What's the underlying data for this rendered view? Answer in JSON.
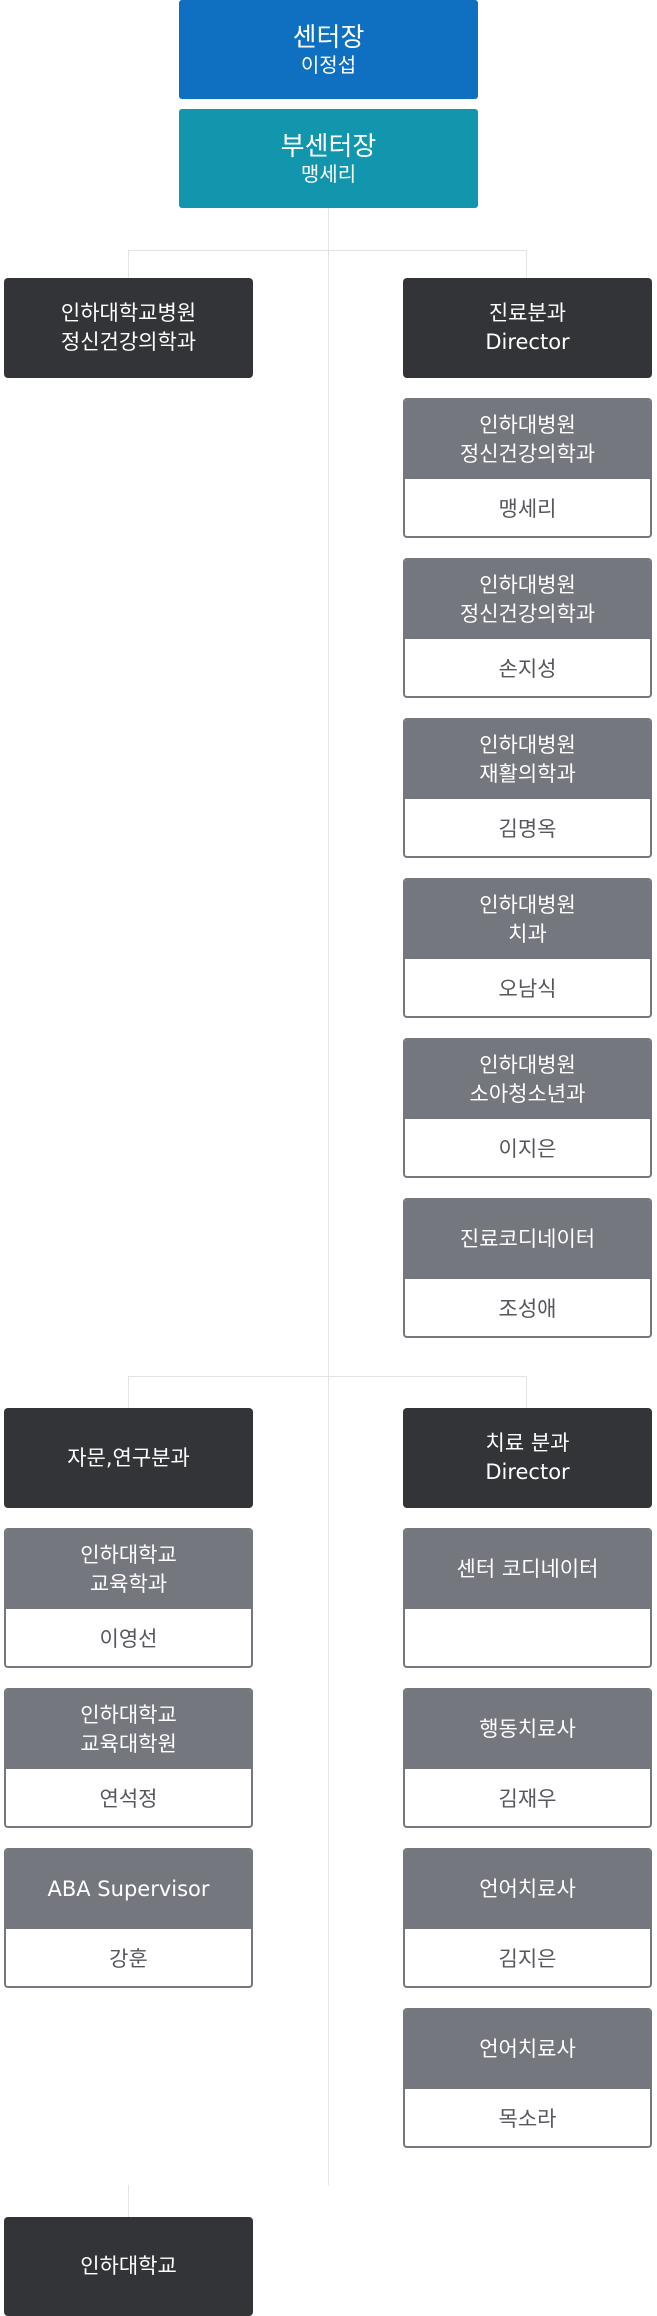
{
  "center_head": {
    "title": "센터장",
    "name": "이정섭"
  },
  "deputy_head": {
    "title": "부센터장",
    "name": "맹세리"
  },
  "left_top": {
    "line1": "인하대학교병원",
    "line2": "정신건강의학과"
  },
  "clinical": {
    "header": {
      "line1": "진료분과",
      "line2": "Director"
    },
    "members": [
      {
        "line1": "인하대병원",
        "line2": "정신건강의학과",
        "name": "맹세리"
      },
      {
        "line1": "인하대병원",
        "line2": "정신건강의학과",
        "name": "손지성"
      },
      {
        "line1": "인하대병원",
        "line2": "재활의학과",
        "name": "김명옥"
      },
      {
        "line1": "인하대병원",
        "line2": "치과",
        "name": "오남식"
      },
      {
        "line1": "인하대병원",
        "line2": "소아청소년과",
        "name": "이지은"
      },
      {
        "line1": "진료코디네이터",
        "line2": "",
        "name": "조성애"
      }
    ]
  },
  "advisory": {
    "header": "자문,연구분과",
    "members": [
      {
        "line1": "인하대학교",
        "line2": "교육학과",
        "name": "이영선"
      },
      {
        "line1": "인하대학교",
        "line2": "교육대학원",
        "name": "연석정"
      },
      {
        "line1": "ABA Supervisor",
        "line2": "",
        "name": "강훈"
      }
    ]
  },
  "treatment": {
    "header": {
      "line1": "치료 분과",
      "line2": "Director"
    },
    "members": [
      {
        "line1": "센터 코디네이터",
        "line2": "",
        "name": ""
      },
      {
        "line1": "행동치료사",
        "line2": "",
        "name": "김재우"
      },
      {
        "line1": "언어치료사",
        "line2": "",
        "name": "김지은"
      },
      {
        "line1": "언어치료사",
        "line2": "",
        "name": "목소라"
      }
    ]
  },
  "bottom": {
    "label": "인하대학교"
  }
}
